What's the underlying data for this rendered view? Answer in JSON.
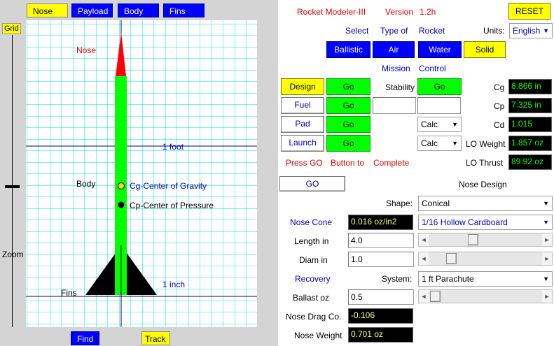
{
  "tabs": [
    {
      "label": "Nose",
      "selected": true
    },
    {
      "label": "Payload",
      "selected": false
    },
    {
      "label": "Body",
      "selected": false
    },
    {
      "label": "Fins",
      "selected": false
    }
  ],
  "left": {
    "grid_label": "Grid",
    "zoom_label": "Zoom",
    "find_label": "Find",
    "track_label": "Track",
    "drawing": {
      "nose_label": "Nose",
      "body_label": "Body",
      "fins_label": "Fins",
      "foot_label": "1 foot",
      "inch_label": "1 inch",
      "cg_label": "Cg-Center of Gravity",
      "cp_label": "Cp-Center of Pressure"
    }
  },
  "header": {
    "app_name": "Rocket Modeler-III",
    "version_label": "Version",
    "version": "1.2h",
    "reset_label": "RESET"
  },
  "select_row": {
    "w1": "Select",
    "w2": "Type of",
    "w3": "Rocket"
  },
  "units": {
    "label": "Units:",
    "value": "English"
  },
  "rocket_types": {
    "ballistic": "Ballistic",
    "air": "Air",
    "water": "Water",
    "solid": "Solid"
  },
  "mission": {
    "w1": "Mission",
    "w2": "Control"
  },
  "mission_buttons": {
    "design": "Design",
    "fuel": "Fuel",
    "pad": "Pad",
    "launch": "Launch",
    "go": "Go"
  },
  "stability": {
    "label": "Stability",
    "go": "Go"
  },
  "calc": {
    "a": "Calc",
    "b": "Calc"
  },
  "readouts": {
    "cg_label": "Cg",
    "cg": "8.866 in",
    "cp_label": "Cp",
    "cp": "7.325 in",
    "cd_label": "Cd",
    "cd": "1.015",
    "lo_weight_label": "LO Weight",
    "lo_weight": "1.857 oz",
    "lo_thrust_label": "LO Thrust",
    "lo_thrust": "89.92 oz"
  },
  "press_go": {
    "w1": "Press GO",
    "w2": "Button to",
    "w3": "Complete"
  },
  "go_button": "GO",
  "nose_design_title": "Nose Design",
  "shape": {
    "label": "Shape:",
    "value": "Conical"
  },
  "nose_cone": {
    "label": "Nose Cone",
    "density": "0.016 oz/in2",
    "material": "1/16 Hollow Cardboard"
  },
  "length": {
    "label": "Length in",
    "value": "4.0",
    "slider_fraction": 0.38
  },
  "diam": {
    "label": "Diam in",
    "value": "1.0",
    "slider_fraction": 0.16
  },
  "recovery": {
    "label": "Recovery",
    "system_label": "System:",
    "system": "1 ft Parachute"
  },
  "ballast": {
    "label": "Ballast oz",
    "value": "0.5",
    "slider_fraction": 0.0
  },
  "drag": {
    "label": "Nose Drag Co.",
    "value": "-0.106"
  },
  "nose_weight": {
    "label": "Nose Weight",
    "value": "0.701 oz"
  },
  "colors": {
    "grid": "#00e5e5",
    "axis": "#000080",
    "body": "#00ff00",
    "nose": "#ff0000",
    "fins": "#000000",
    "cg_dot": "#ffd700",
    "cp_dot": "#000000",
    "blue_button": "#0000ff",
    "yellow_button": "#ffff00",
    "go_green": "#00ff00",
    "readout_green": "#00ff00",
    "readout_yellow": "#ffff66"
  }
}
